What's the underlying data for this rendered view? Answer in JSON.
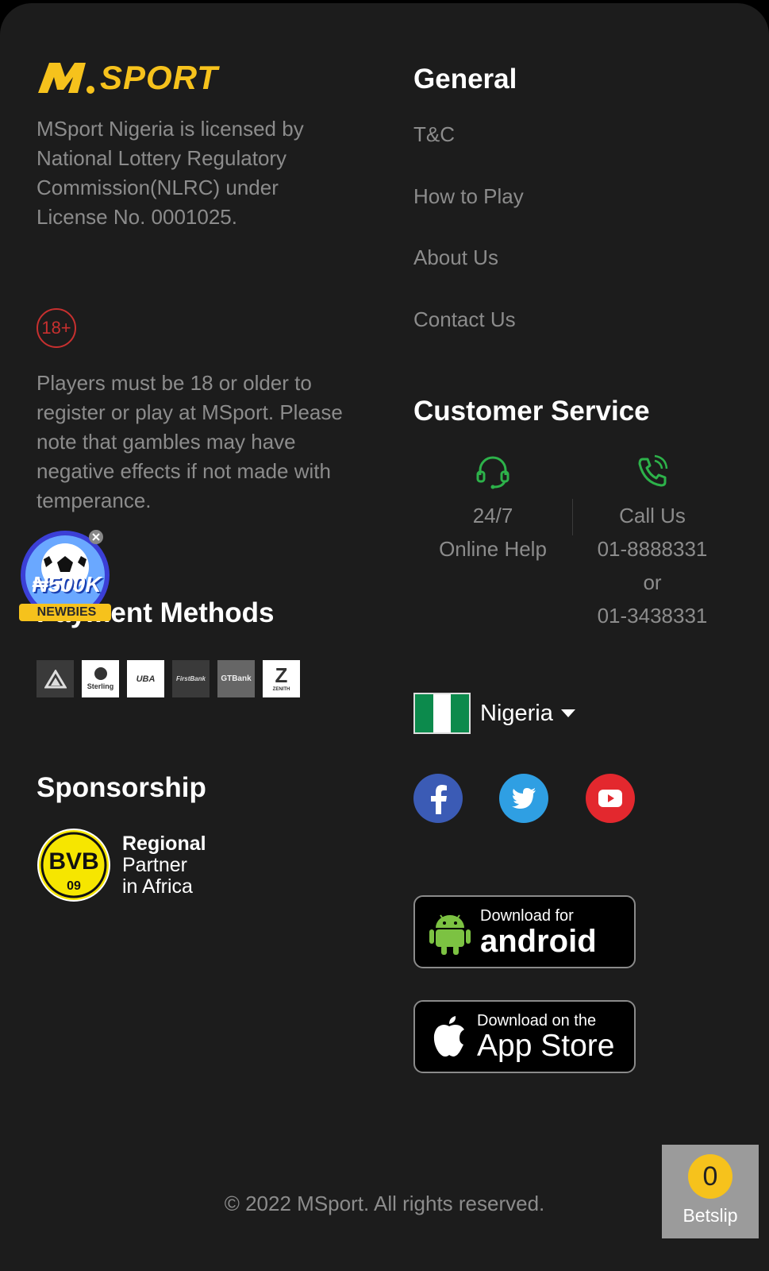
{
  "brand": {
    "name": "SPORT"
  },
  "license_text": "MSport Nigeria is licensed by National Lottery Regulatory Commission(NLRC) under License No. 0001025.",
  "age_badge": "18+",
  "age_notice": "Players must be 18 or older to register or play at MSport. Please note that gambles may have negative effects if not made with temperance.",
  "payment": {
    "title": "Payment Methods",
    "logos": [
      "ALAT",
      "Sterling",
      "UBA",
      "FirstBank",
      "GTBank",
      "ZENITH"
    ]
  },
  "sponsorship": {
    "title": "Sponsorship",
    "badge": "BVB 09",
    "line1": "Regional",
    "line2": "Partner",
    "line3": "in Africa"
  },
  "general": {
    "title": "General",
    "links": [
      "T&C",
      "How to Play",
      "About Us",
      "Contact Us"
    ]
  },
  "customer_service": {
    "title": "Customer Service",
    "online_line1": "24/7",
    "online_line2": "Online Help",
    "call_label": "Call Us",
    "phone1": "01-8888331",
    "or": "or",
    "phone2": "01-3438331"
  },
  "country": {
    "name": "Nigeria"
  },
  "social": [
    "facebook-icon",
    "twitter-icon",
    "youtube-icon"
  ],
  "apps": {
    "android_small": "Download for",
    "android_big": "android",
    "ios_small": "Download on the",
    "ios_big": "App Store"
  },
  "promo": {
    "amount": "₦500K",
    "label": "NEWBIES"
  },
  "copyright": "© 2022 MSport. All rights reserved.",
  "betslip": {
    "count": "0",
    "label": "Betslip"
  },
  "colors": {
    "accent": "#f6c21c",
    "background": "#1c1c1c",
    "muted_text": "#8c8c8c",
    "cs_icon": "#2db24a"
  }
}
